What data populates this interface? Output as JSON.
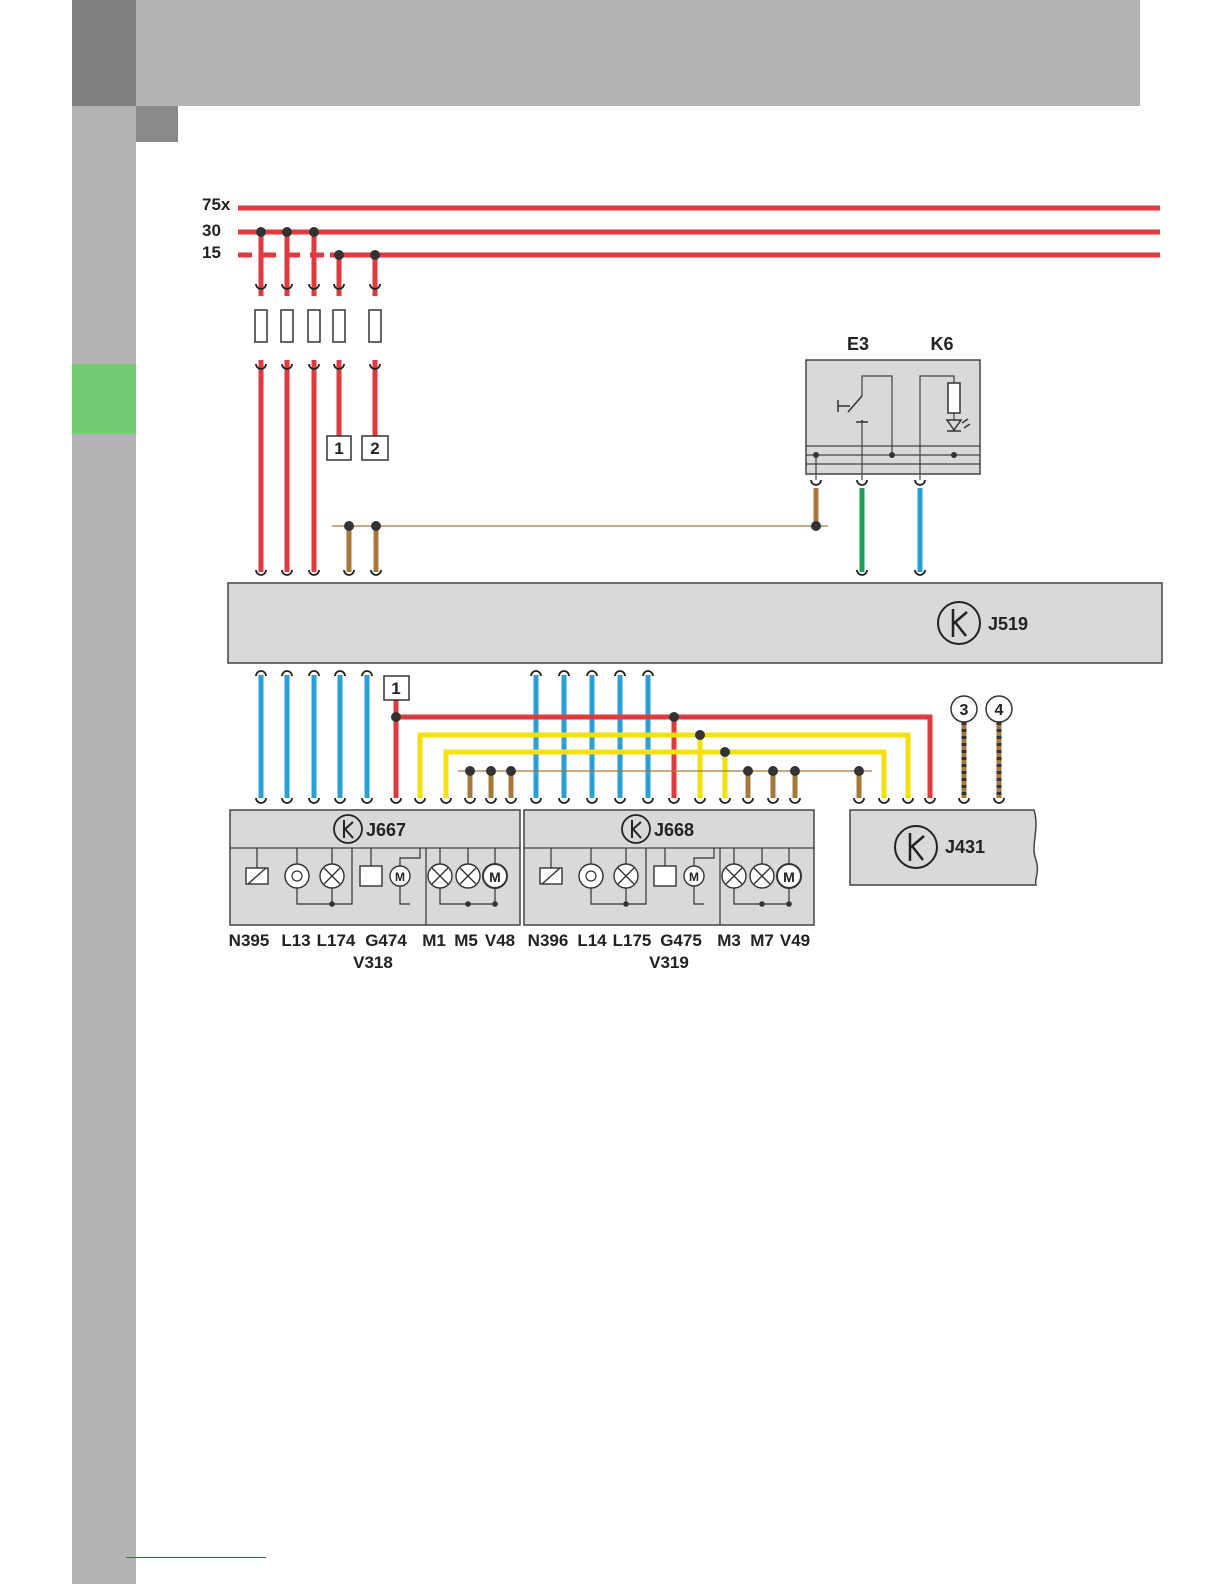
{
  "colors": {
    "red": "#e03a3e",
    "blue": "#2a9fd6",
    "yellow": "#f2e10f",
    "brown": "#a8783a",
    "green": "#1e9e55",
    "box_fill": "#d9d9d9",
    "box_stroke": "#444444",
    "junction": "#333333"
  },
  "diagram": {
    "rails": [
      "75x",
      "30",
      "15"
    ],
    "fuse_outputs": [
      "1",
      "2"
    ],
    "connection_refs": [
      "1"
    ],
    "circled_refs": [
      "3",
      "4"
    ],
    "units": {
      "switch_panel": {
        "left_label": "E3",
        "right_label": "K6"
      },
      "main_module": {
        "label": "J519"
      },
      "door_left": {
        "label": "J667"
      },
      "door_right": {
        "label": "J668"
      },
      "headlight_unit": {
        "label": "J431"
      }
    },
    "door_left_components": {
      "row1": [
        "N395",
        "L13",
        "L174",
        "G474",
        "M1",
        "M5",
        "V48"
      ],
      "row2": [
        "V318"
      ]
    },
    "door_right_components": {
      "row1": [
        "N396",
        "L14",
        "L175",
        "G475",
        "M3",
        "M7",
        "V49"
      ],
      "row2": [
        "V319"
      ]
    }
  }
}
